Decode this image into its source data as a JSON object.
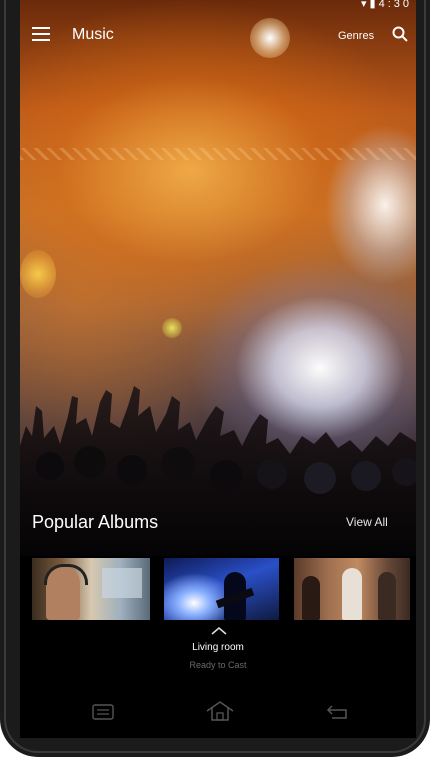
{
  "status_bar": {
    "time": "4:30"
  },
  "app_bar": {
    "title": "Music",
    "genres_label": "Genres"
  },
  "hero": {
    "section_title": "Popular Albums",
    "view_all_label": "View All"
  },
  "cast": {
    "device_name": "Living room",
    "status": "Ready to Cast"
  },
  "icons": {
    "menu": "menu-icon",
    "search": "search-icon",
    "chevron": "chevron-up-icon",
    "recent": "recent-apps-icon",
    "home": "home-icon",
    "back": "back-icon"
  },
  "colors": {
    "accent": "#ffffff",
    "cast_status": "#6a6a6a",
    "background": "#000000"
  }
}
